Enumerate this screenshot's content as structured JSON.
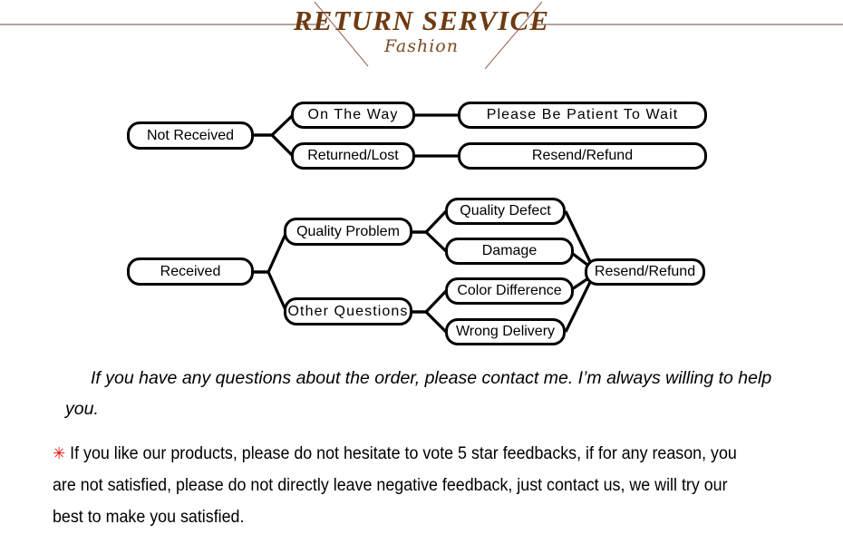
{
  "header": {
    "title": "RETURN SERVICE",
    "subtitle": "Fashion",
    "title_color": "#6E3A10",
    "rule_color": "#8B6A5C",
    "diagonal_color": "#9A6B63"
  },
  "flowchart": {
    "branch_not_received": {
      "root": "Not Received",
      "children": [
        {
          "label": "On The Way",
          "outcome": "Please Be Patient To Wait"
        },
        {
          "label": "Returned/Lost",
          "outcome": "Resend/Refund"
        }
      ]
    },
    "branch_received": {
      "root": "Received",
      "categories": [
        {
          "label": "Quality Problem",
          "reasons": [
            "Quality Defect",
            "Damage"
          ]
        },
        {
          "label": "Other Questions",
          "reasons": [
            "Color Difference",
            "Wrong Delivery"
          ]
        }
      ],
      "outcome": "Resend/Refund"
    },
    "nodes": {
      "not_received": "Not Received",
      "on_the_way": "On The Way",
      "returned_lost": "Returned/Lost",
      "please_be_patient": "Please Be Patient To Wait",
      "resend_refund_top": "Resend/Refund",
      "received": "Received",
      "quality_problem": "Quality Problem",
      "other_questions": "Other Questions",
      "quality_defect": "Quality Defect",
      "damage": "Damage",
      "color_difference": "Color Difference",
      "wrong_delivery": "Wrong Delivery",
      "resend_refund_bottom": "Resend/Refund"
    }
  },
  "paragraphs": {
    "contact": "If you have any questions about the order, please contact me. I’m always willing to help you.",
    "asterisk_symbol": "✳",
    "feedback": "If you like our products, please do not hesitate to vote 5 star feedbacks, if for any reason, you are not satisfied, please do not directly leave negative feedback, just contact us, we will try our best to make you satisfied."
  }
}
